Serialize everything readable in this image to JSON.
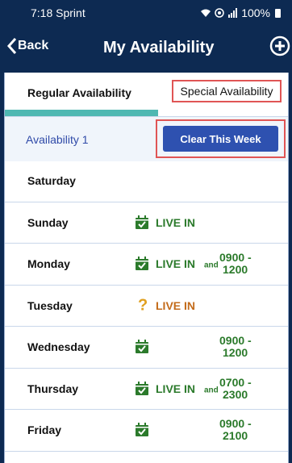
{
  "status_bar": {
    "time": "7:18 Sprint",
    "battery": "100%"
  },
  "header": {
    "back_label": "Back",
    "title": "My Availability"
  },
  "tabs": {
    "regular": "Regular Availability",
    "special": "Special Availability"
  },
  "availability": {
    "label": "Availability 1",
    "clear_button": "Clear This Week"
  },
  "and_label": "and",
  "days": [
    {
      "name": "Saturday",
      "icon": "",
      "live": "",
      "time1": "",
      "time2": ""
    },
    {
      "name": "Sunday",
      "icon": "calendar-check-icon",
      "live": "LIVE IN",
      "time1": "",
      "time2": ""
    },
    {
      "name": "Monday",
      "icon": "calendar-check-icon",
      "live": "LIVE IN",
      "time1": "0900 -",
      "time2": "1200"
    },
    {
      "name": "Tuesday",
      "icon": "question-icon",
      "live": "LIVE IN",
      "time1": "",
      "time2": ""
    },
    {
      "name": "Wednesday",
      "icon": "calendar-check-icon",
      "live": "",
      "time1": "0900 -",
      "time2": "1200"
    },
    {
      "name": "Thursday",
      "icon": "calendar-check-icon",
      "live": "LIVE IN",
      "time1": "0700 -",
      "time2": "2300"
    },
    {
      "name": "Friday",
      "icon": "calendar-check-icon",
      "live": "",
      "time1": "0900 -",
      "time2": "2100"
    }
  ],
  "colors": {
    "navy": "#0d2a52",
    "green": "#2b7a2b",
    "blue_button": "#2e51b0",
    "accent_teal": "#4fb8b2",
    "highlight_red": "#e05555",
    "orange": "#c36b1a"
  }
}
